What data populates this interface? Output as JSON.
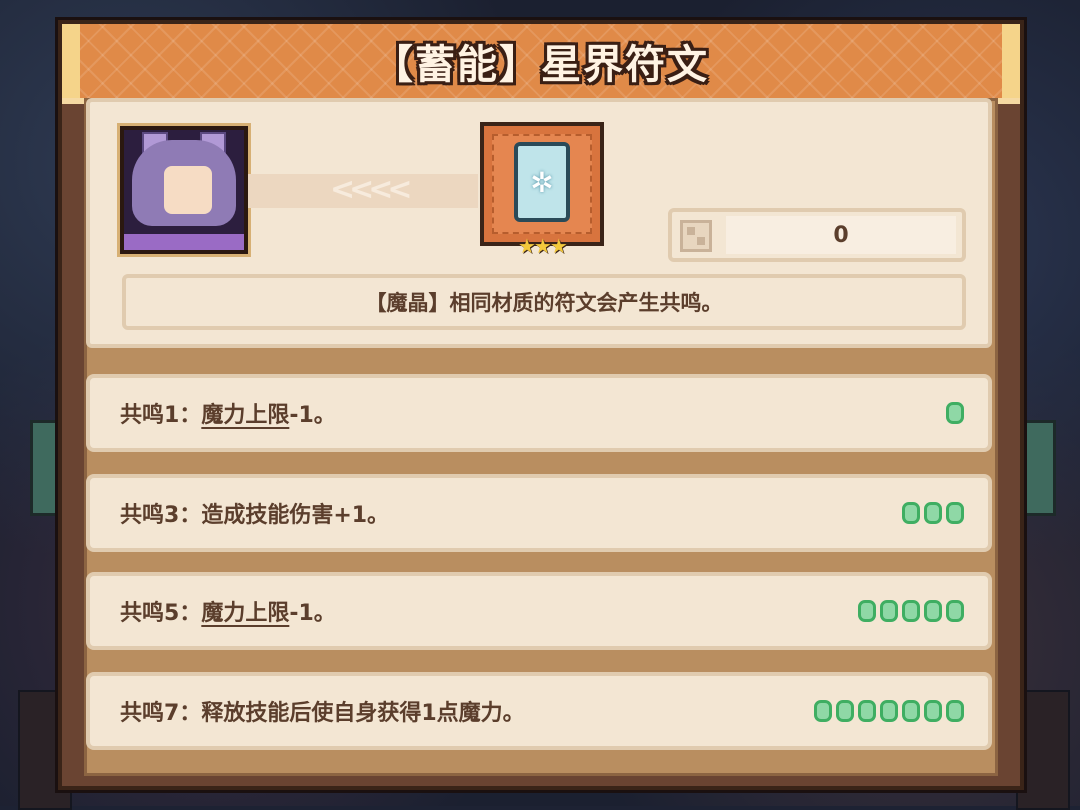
{
  "panel": {
    "title": "【蓄能】星界符文"
  },
  "rune": {
    "stars": "★★★",
    "glyph": "✲",
    "count": "0"
  },
  "description": "【魔晶】相同材质的符文会产生共鸣。",
  "resonances": [
    {
      "prefix": "共鸣1：",
      "keyword": "魔力上限",
      "suffix": "-1。",
      "pips": 1
    },
    {
      "prefix": "共鸣3：",
      "keyword": "",
      "suffix": "造成技能伤害+1。",
      "pips": 3
    },
    {
      "prefix": "共鸣5：",
      "keyword": "魔力上限",
      "suffix": "-1。",
      "pips": 5
    },
    {
      "prefix": "共鸣7：",
      "keyword": "",
      "suffix": "释放技能后使自身获得1点魔力。",
      "pips": 7
    }
  ],
  "colors": {
    "pip_fill": "#8fd8a6",
    "pip_border": "#3fae62",
    "banner": "#e08a48"
  }
}
